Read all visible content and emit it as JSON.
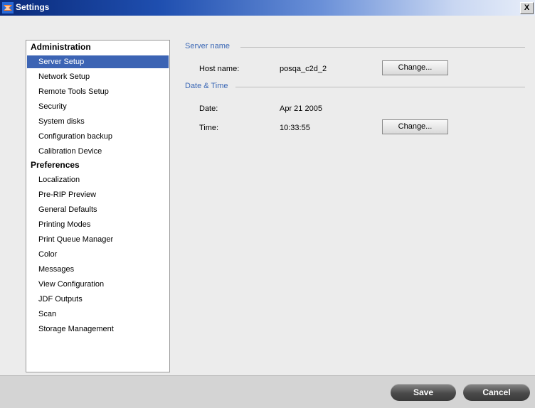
{
  "window": {
    "title": "Settings",
    "close_label": "X"
  },
  "nav": {
    "sections": [
      {
        "header": "Administration",
        "items": [
          "Server Setup",
          "Network Setup",
          "Remote Tools Setup",
          "Security",
          "System disks",
          "Configuration backup",
          "Calibration Device"
        ]
      },
      {
        "header": "Preferences",
        "items": [
          "Localization",
          "Pre-RIP Preview",
          "General Defaults",
          "Printing Modes",
          "Print Queue Manager",
          "Color",
          "Messages",
          "View Configuration",
          "JDF Outputs",
          "Scan",
          "Storage Management"
        ]
      }
    ],
    "selected": "Server Setup"
  },
  "server_name": {
    "section_label": "Server name",
    "host_label": "Host name:",
    "host_value": "posqa_c2d_2",
    "change_label": "Change..."
  },
  "date_time": {
    "section_label": "Date & Time",
    "date_label": "Date:",
    "date_value": "Apr 21 2005",
    "time_label": "Time:",
    "time_value": "10:33:55",
    "change_label": "Change..."
  },
  "footer": {
    "save_label": "Save",
    "cancel_label": "Cancel"
  },
  "colors": {
    "accent": "#3c64b4",
    "section_text": "#3a67b5",
    "title_bar": "#0a2a7a"
  }
}
